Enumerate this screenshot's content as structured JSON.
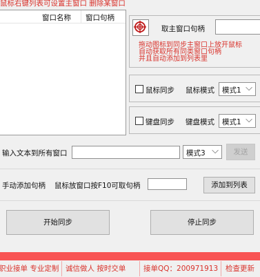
{
  "header": {
    "hint_text": "鼠标右键列表可设置主窗口 删除某窗口"
  },
  "window_list": {
    "columns": [
      "窗口名称",
      "窗口句柄"
    ],
    "rows": []
  },
  "main_window": {
    "label": "取主窗口句柄",
    "instruction_lines": [
      "拖动图标到同步主窗口上放开鼠标",
      "自动获取所有同类窗口句柄",
      "并且自动添加到列表里"
    ],
    "handle_value": ""
  },
  "mouse_sync": {
    "checkbox_label": "鼠标同步",
    "mode_label": "鼠标模式",
    "mode_value": "模式1"
  },
  "keyboard_sync": {
    "checkbox_label": "键盘同步",
    "mode_label": "键盘模式",
    "mode_value": "模式1"
  },
  "text_send": {
    "label": "输入文本到所有窗口",
    "text_value": "",
    "mode_value": "模式3",
    "send_label": "发送"
  },
  "manual_add": {
    "label": "手动添加句柄",
    "hint": "鼠标放窗口按F10可取句柄",
    "handle_value": "",
    "add_label": "添加到列表"
  },
  "actions": {
    "start_label": "开始同步",
    "stop_label": "停止同步"
  },
  "footer": {
    "link1": "职业接单 专业定制",
    "link2": "诚信做人 按时交单",
    "link3": "接单QQ：200971913",
    "link4": "检查更新"
  }
}
